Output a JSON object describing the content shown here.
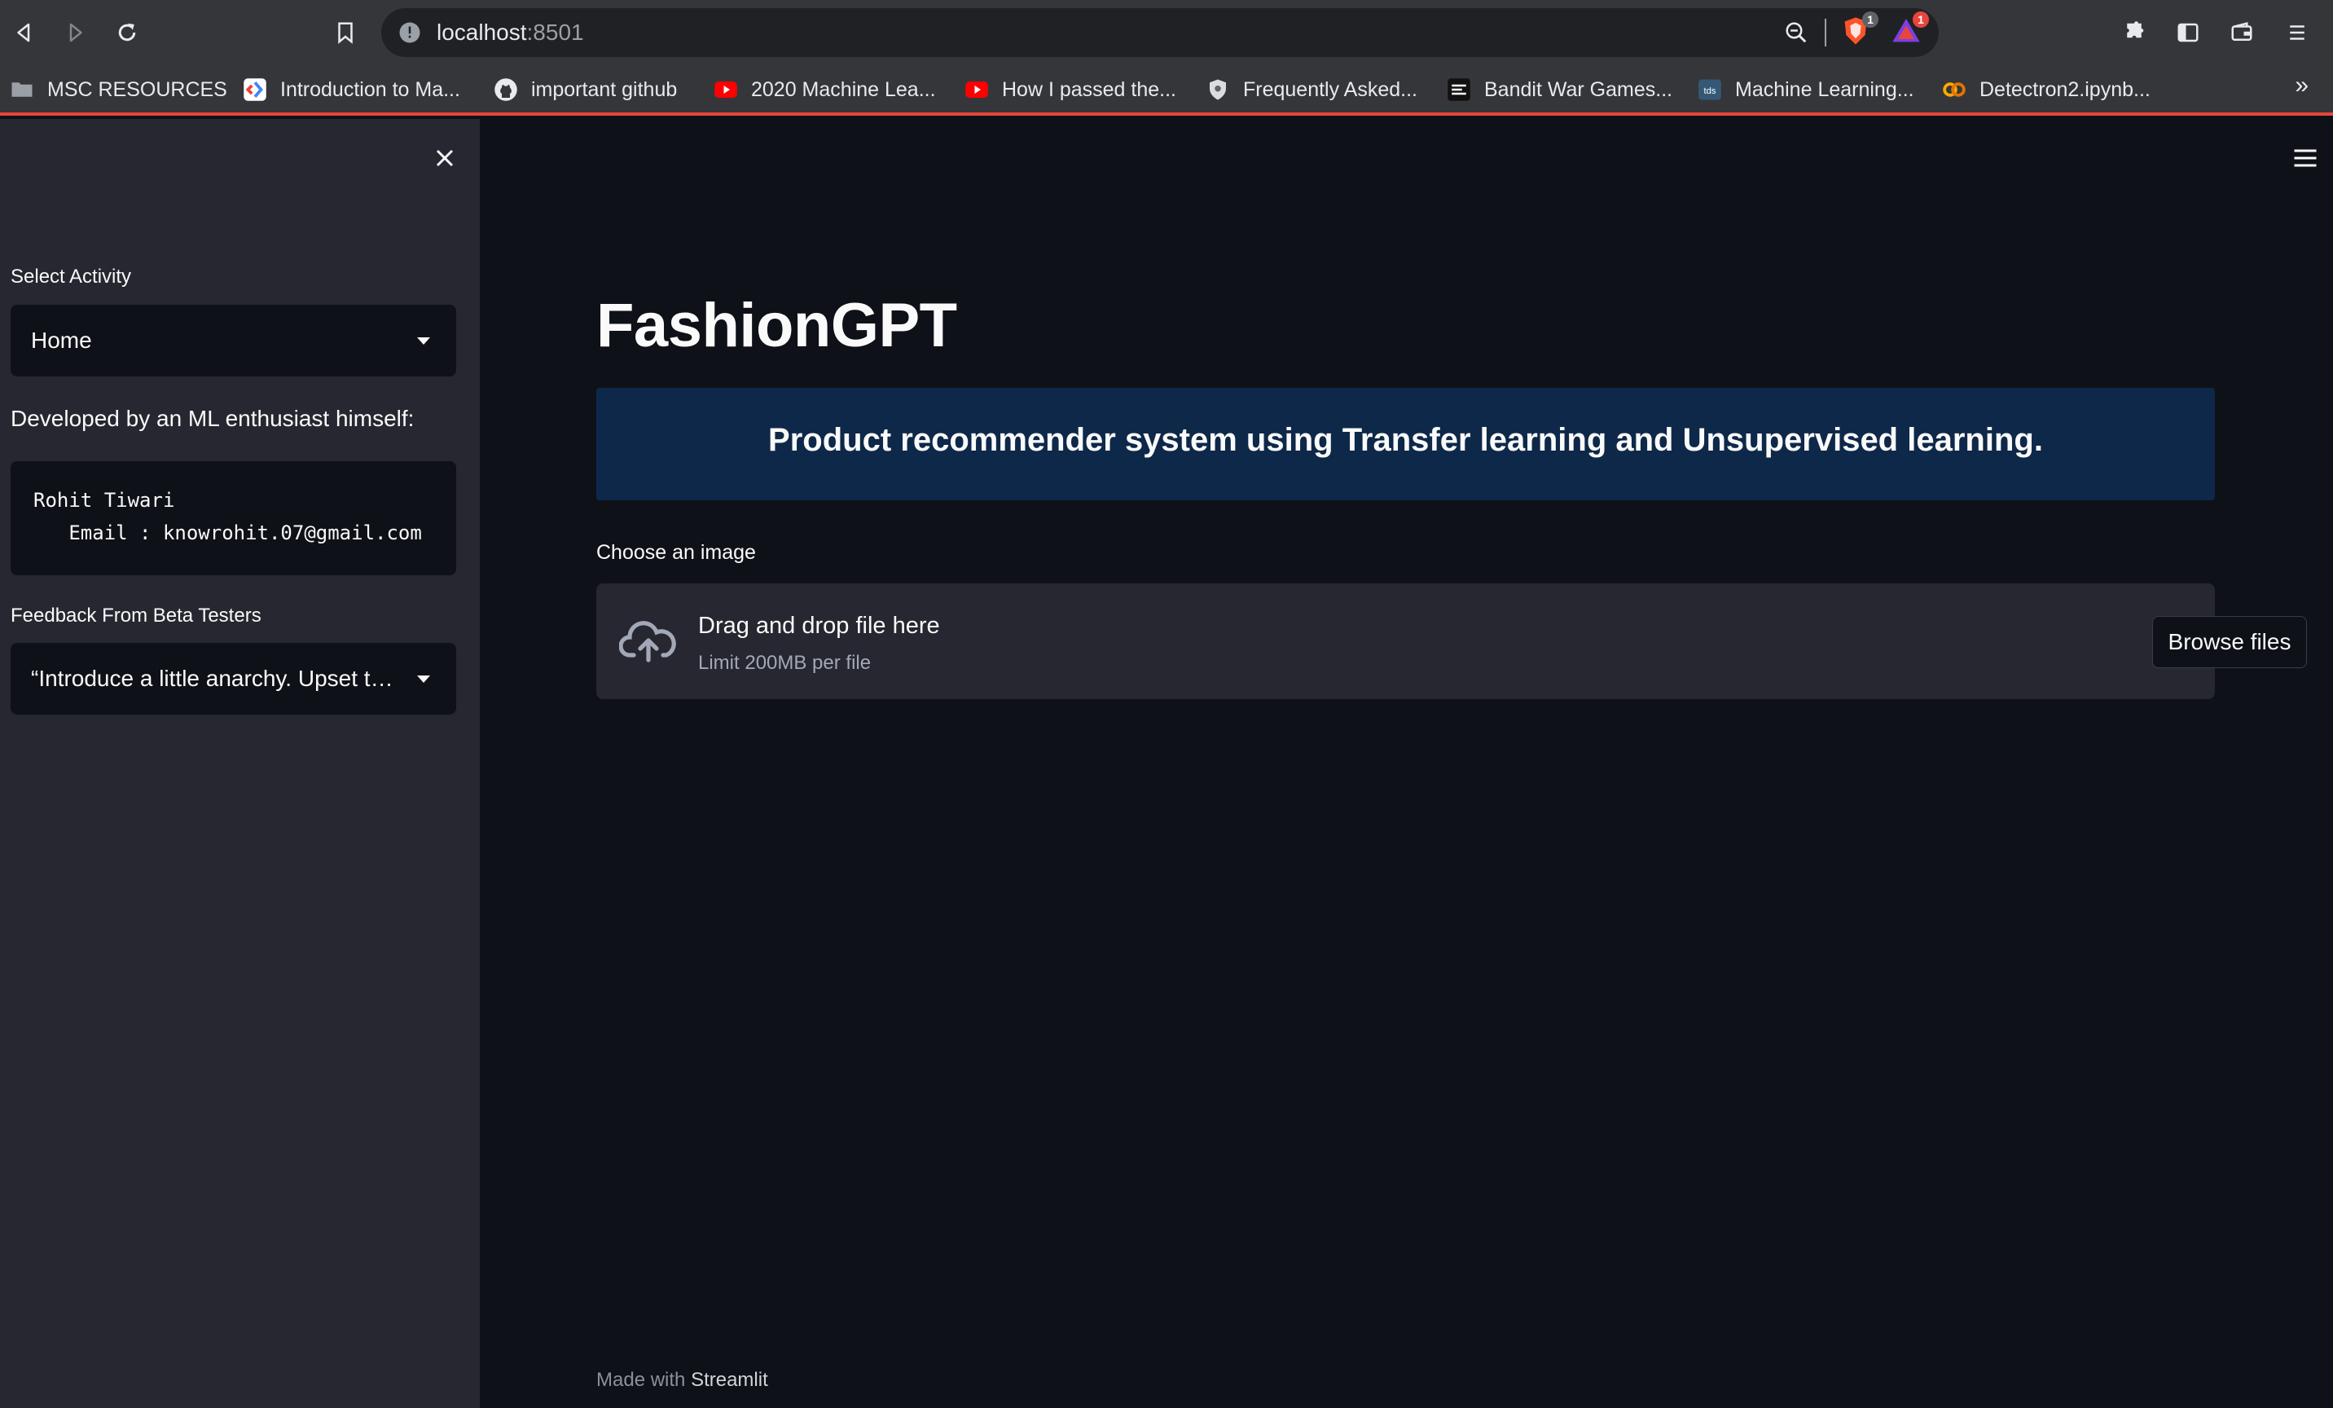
{
  "browser": {
    "url_host": "localhost",
    "url_port": ":8501",
    "extensions": [
      {
        "name": "brave-shields-icon",
        "count": "1",
        "color": "#fb542b"
      },
      {
        "name": "brave-rewards-icon",
        "count": "1",
        "color": "#e8453c"
      }
    ],
    "bookmarks": [
      {
        "label": "MSC RESOURCES",
        "icon": "folder-icon"
      },
      {
        "label": "Introduction to Ma...",
        "icon": "colab-icon"
      },
      {
        "label": "important github",
        "icon": "github-icon"
      },
      {
        "label": "2020 Machine Lea...",
        "icon": "youtube-icon"
      },
      {
        "label": "How I passed the...",
        "icon": "youtube-icon"
      },
      {
        "label": "Frequently Asked...",
        "icon": "shield-icon"
      },
      {
        "label": "Bandit War Games...",
        "icon": "overthewire-icon"
      },
      {
        "label": "Machine Learning...",
        "icon": "tds-icon"
      },
      {
        "label": "Detectron2.ipynb...",
        "icon": "colab-icon"
      }
    ],
    "overflow_label": "»"
  },
  "sidebar": {
    "select_activity_label": "Select Activity",
    "select_activity_value": "Home",
    "developer_text": "Developed by an ML enthusiast himself:",
    "developer_code_line1": "Rohit Tiwari",
    "developer_code_line2": "   Email : knowrohit.07@gmail.com",
    "feedback_label": "Feedback From Beta Testers",
    "feedback_value": "“Introduce a little anarchy. Upset the established order, and everything becomes chaos. I'm an agent of chaos. Oh, and you know the thing about chaos? It's fair.”"
  },
  "main": {
    "title": "FashionGPT",
    "banner_text": "Product recommender system using Transfer learning and Unsupervised learning.",
    "uploader_label": "Choose an image",
    "dropzone_title": "Drag and drop file here",
    "dropzone_limit": "Limit 200MB per file",
    "browse_button": "Browse files",
    "footer_prefix": "Made with ",
    "footer_brand": "Streamlit"
  },
  "colors": {
    "sidebar_bg": "#262730",
    "main_bg": "#0e1117",
    "banner_bg": "#0e2849",
    "bookmarks_underline": "#e8453c"
  }
}
